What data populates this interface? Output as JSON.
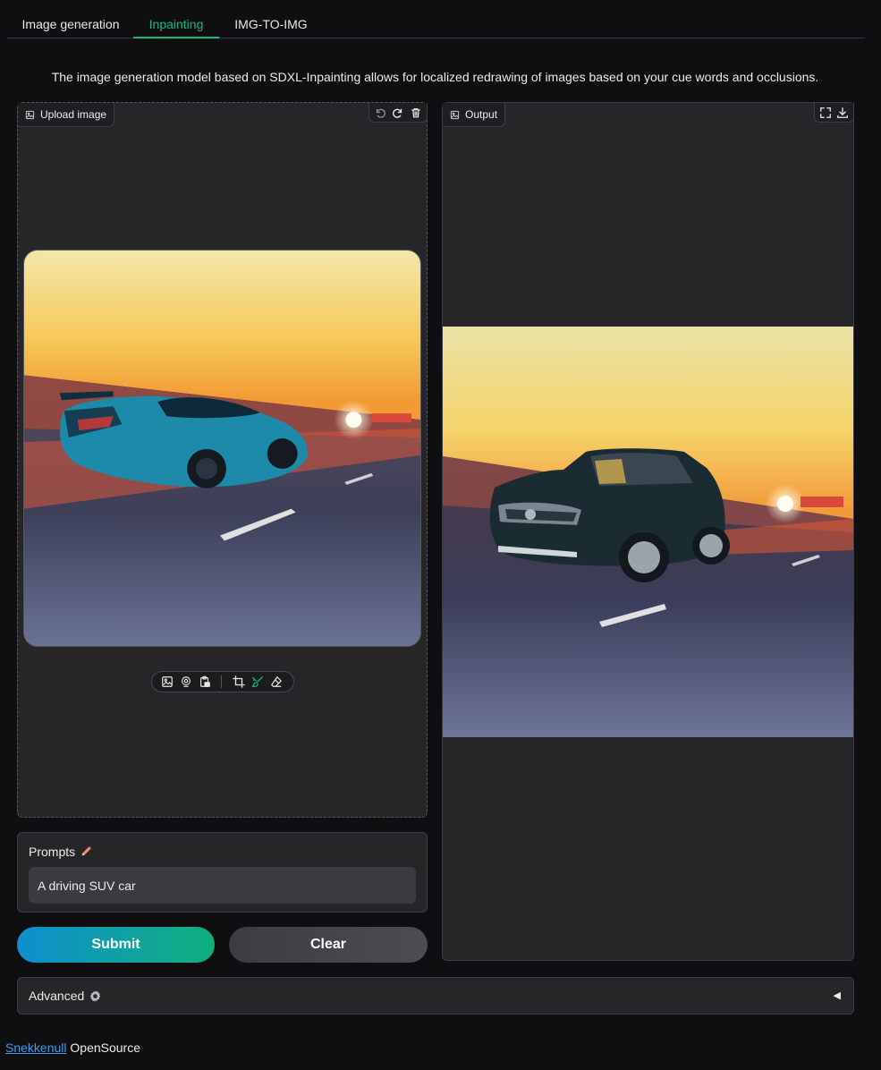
{
  "tabs": [
    {
      "label": "Image generation",
      "active": false
    },
    {
      "label": "Inpainting",
      "active": true
    },
    {
      "label": "IMG-TO-IMG",
      "active": false
    }
  ],
  "description": "The image generation model based on SDXL-Inpainting allows for localized redrawing of images based on your cue words and occlusions.",
  "upload_panel": {
    "label": "Upload image",
    "label_icon": "image-icon",
    "actions": [
      "undo-icon",
      "redo-icon",
      "trash-icon"
    ],
    "image_description": "blue sports car on highway at sunset",
    "toolbar": {
      "source_icons": [
        "image-icon",
        "webcam-icon",
        "clipboard-icon"
      ],
      "edit_icons": [
        "crop-icon",
        "brush-icon",
        "eraser-icon"
      ],
      "active_tool": "brush-icon"
    }
  },
  "output_panel": {
    "label": "Output",
    "label_icon": "image-icon",
    "actions": [
      "fullscreen-icon",
      "download-icon"
    ],
    "image_description": "dark SUV on highway at sunset"
  },
  "prompts": {
    "label": "Prompts",
    "label_icon": "pencil-icon",
    "value": "A driving SUV car"
  },
  "buttons": {
    "submit": "Submit",
    "clear": "Clear"
  },
  "advanced": {
    "label": "Advanced",
    "label_icon": "gear-icon",
    "caret": "◀"
  },
  "footer": {
    "link_text": "Snekkenull",
    "text": "OpenSource"
  },
  "colors": {
    "accent": "#10b981",
    "link": "#3b9cf0",
    "background": "#0f0f11",
    "panel": "#262628"
  }
}
